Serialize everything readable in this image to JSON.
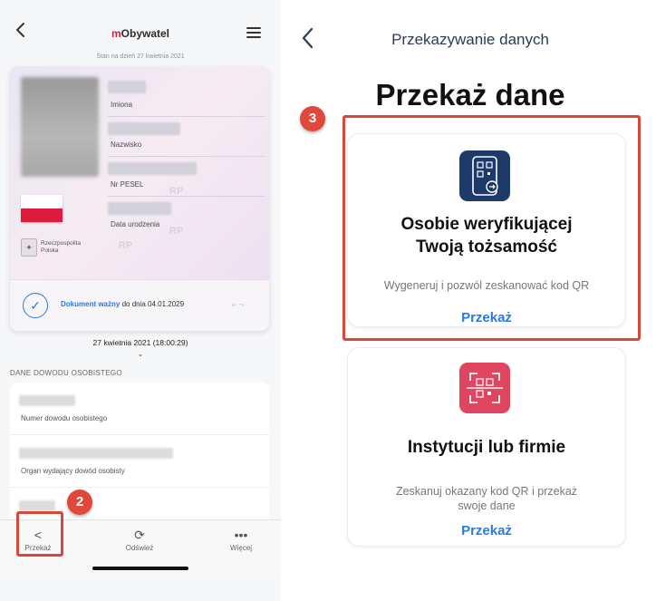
{
  "left": {
    "app_title_prefix": "m",
    "app_title_rest": "Obywatel",
    "as_of": "Stan na dzień 27 kwietnia 2021",
    "card": {
      "field_names": "Imiona",
      "field_surname": "Nazwisko",
      "field_pesel": "Nr PESEL",
      "field_dob": "Data urodzenia",
      "country": "Rzeczpospolita Polska",
      "watermark": "RP",
      "validity_label": "Dokument ważny",
      "validity_rest": " do dnia 04.01.2029"
    },
    "timestamp": "27 kwietnia 2021 (18:00:29)",
    "section_title": "DANE DOWODU OSOBISTEGO",
    "list": [
      {
        "label": "Numer dowodu osobistego"
      },
      {
        "label": "Organ wydający dowód osobisty"
      }
    ],
    "tabs": {
      "share": "Przekaż",
      "refresh": "Odśwież",
      "more": "Więcej"
    },
    "badge": "2"
  },
  "right": {
    "title": "Przekazywanie danych",
    "heading": "Przekaż dane",
    "badge": "3",
    "option1": {
      "title_line1": "Osobie weryfikującej",
      "title_line2": "Twoją tożsamość",
      "desc": "Wygeneruj i pozwól zeskanować kod QR",
      "action": "Przekaż",
      "icon_color": "#1e3a6b"
    },
    "option2": {
      "title": "Instytucji lub firmie",
      "desc_line1": "Zeskanuj okazany kod QR i przekaż",
      "desc_line2": "swoje dane",
      "action": "Przekaż",
      "icon_color": "#e04560"
    }
  },
  "colors": {
    "accent": "#2a7ae2",
    "highlight": "#d9473b",
    "brand_red": "#d4213d"
  }
}
